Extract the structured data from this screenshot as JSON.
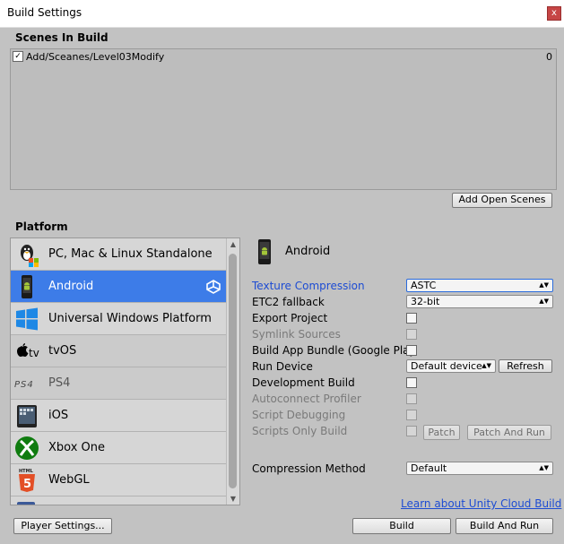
{
  "window": {
    "title": "Build Settings",
    "close_label": "x"
  },
  "scenes": {
    "header": "Scenes In Build",
    "items": [
      {
        "name": "Add/Sceanes/Level03Modify",
        "index": "0",
        "checked": true
      }
    ],
    "add_open_scenes_label": "Add Open Scenes"
  },
  "platform": {
    "header": "Platform",
    "items": [
      {
        "label": "PC, Mac & Linux Standalone",
        "icon": "pc-mac-linux-icon"
      },
      {
        "label": "Android",
        "icon": "android-icon",
        "selected": true
      },
      {
        "label": "Universal Windows Platform",
        "icon": "windows-icon"
      },
      {
        "label": "tvOS",
        "icon": "appletv-icon"
      },
      {
        "label": "PS4",
        "icon": "ps4-icon"
      },
      {
        "label": "iOS",
        "icon": "ios-icon"
      },
      {
        "label": "Xbox One",
        "icon": "xbox-icon"
      },
      {
        "label": "WebGL",
        "icon": "html5-icon"
      }
    ]
  },
  "android": {
    "title": "Android",
    "texture_compression": {
      "label": "Texture Compression",
      "value": "ASTC"
    },
    "etc2_fallback": {
      "label": "ETC2 fallback",
      "value": "32-bit"
    },
    "export_project": {
      "label": "Export Project"
    },
    "symlink_sources": {
      "label": "Symlink Sources"
    },
    "build_app_bundle": {
      "label": "Build App Bundle (Google Play"
    },
    "run_device": {
      "label": "Run Device",
      "value": "Default device",
      "refresh_label": "Refresh"
    },
    "development_build": {
      "label": "Development Build"
    },
    "autoconnect_profiler": {
      "label": "Autoconnect Profiler"
    },
    "script_debugging": {
      "label": "Script Debugging"
    },
    "scripts_only_build": {
      "label": "Scripts Only Build",
      "patch_label": "Patch",
      "patch_and_run_label": "Patch And Run"
    },
    "compression_method": {
      "label": "Compression Method",
      "value": "Default"
    }
  },
  "footer": {
    "cloud_link": "Learn about Unity Cloud Build",
    "player_settings_label": "Player Settings...",
    "build_label": "Build",
    "build_and_run_label": "Build And Run"
  },
  "colors": {
    "selection": "#3d7ce8",
    "link": "#1d4cd3",
    "background": "#c2c2c2"
  }
}
